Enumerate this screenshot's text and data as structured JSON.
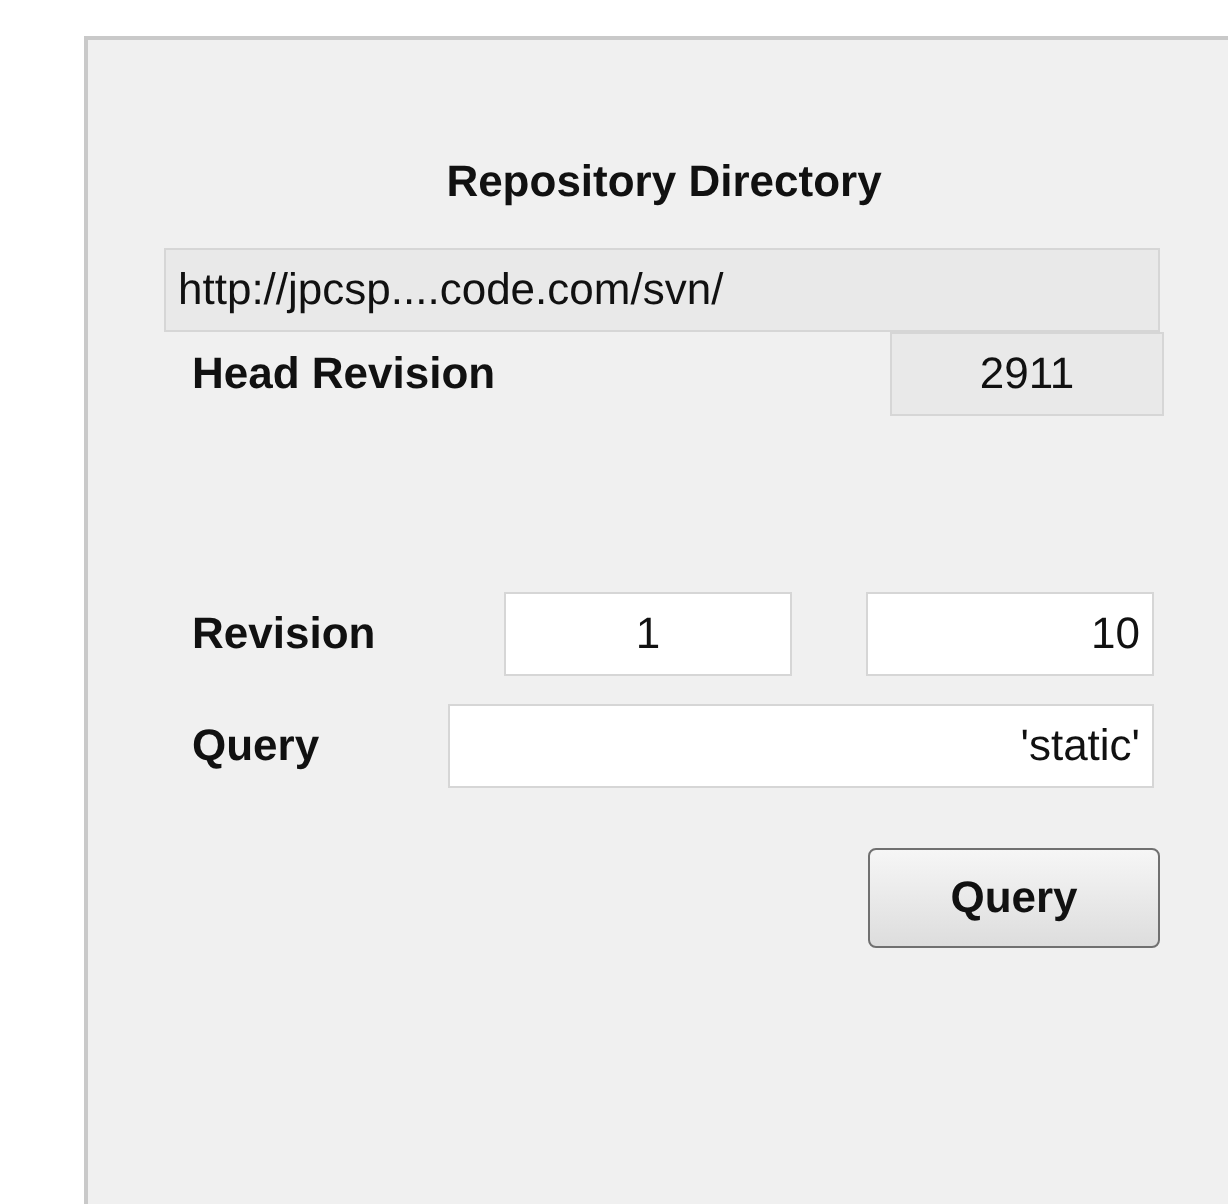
{
  "title": "Repository Directory",
  "repository_url": {
    "value": "http://jpcsp....code.com/svn/",
    "disabled": true
  },
  "head_revision": {
    "label": "Head Revision",
    "value": "2911",
    "disabled": true
  },
  "revision": {
    "label": "Revision",
    "from": "1",
    "to": "10"
  },
  "query": {
    "label": "Query",
    "value": "'static'"
  },
  "query_button": "Query"
}
